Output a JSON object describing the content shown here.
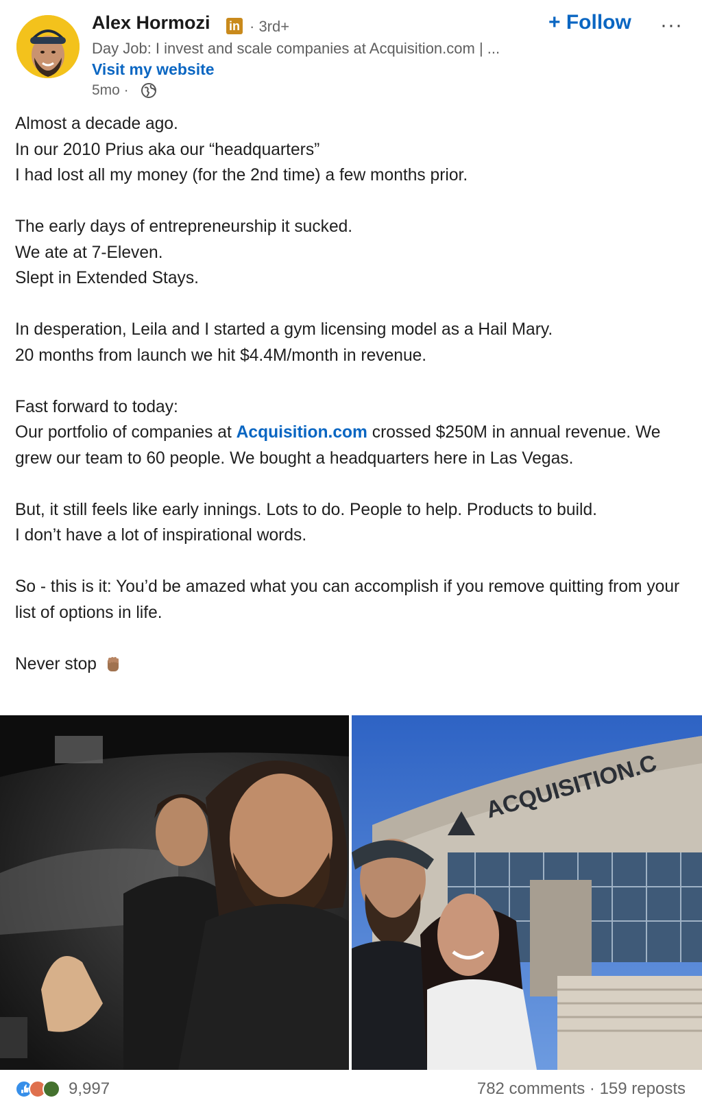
{
  "author": {
    "name": "Alex Hormozi",
    "badge": "in",
    "degree": "· 3rd+",
    "headline": "Day Job: I invest and scale companies at Acquisition.com | ...",
    "website_label": "Visit my website",
    "time": "5mo ·"
  },
  "actions": {
    "follow_label": "+ Follow",
    "more_label": "···"
  },
  "post": {
    "p1": [
      "Almost a decade ago.",
      "In our 2010 Prius aka our “headquarters”",
      "I had lost all my money (for the 2nd time) a few months prior."
    ],
    "p2": [
      "The early days of entrepreneurship it sucked.",
      "We ate at 7-Eleven.",
      "Slept in Extended Stays."
    ],
    "p3": [
      "In desperation, Leila and I started a gym licensing model as a Hail Mary.",
      "20 months from launch we hit $4.4M/month in revenue."
    ],
    "p4_line1": "Fast forward to today:",
    "p4_pre": "Our portfolio of companies at ",
    "p4_link": "Acquisition.com",
    "p4_post": " crossed $250M in annual revenue. We grew our team to 60 people. We bought a headquarters here in Las Vegas.",
    "p5": [
      "But, it still feels like early innings. Lots to do. People to help. Products to build.",
      "I don’t have a lot of inspirational words."
    ],
    "p6": "So - this is it: You’d be amazed what you can accomplish if you remove quitting from your list of options in life.",
    "p7": "Never stop"
  },
  "photos": {
    "building_sign": "ACQUISITION.C"
  },
  "footer": {
    "reaction_count": "9,997",
    "engagement": "782 comments · 159 reposts"
  },
  "colors": {
    "link": "#0a66c2",
    "muted": "#666666",
    "linkedin_badge": "#c98a1c"
  }
}
